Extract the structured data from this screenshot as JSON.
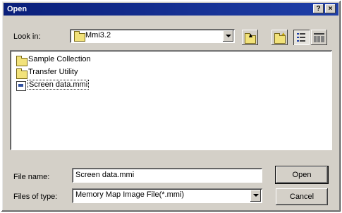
{
  "window": {
    "title": "Open",
    "help_button": "?",
    "close_button": "×"
  },
  "look_in": {
    "label": "Look in:",
    "value": "Mmi3.2"
  },
  "toolbar": {
    "icons": [
      "up-one-level-icon",
      "new-folder-icon",
      "list-view-icon",
      "details-view-icon"
    ],
    "active": "list-view-icon"
  },
  "files": [
    {
      "name": "Sample Collection",
      "type": "folder"
    },
    {
      "name": "Transfer Utility",
      "type": "folder"
    },
    {
      "name": "Screen data.mmi",
      "type": "file",
      "selected": true
    }
  ],
  "file_name": {
    "label": "File name:",
    "value": "Screen data.mmi"
  },
  "file_type": {
    "label": "Files of type:",
    "value": "Memory Map Image File(*.mmi)"
  },
  "buttons": {
    "open": "Open",
    "cancel": "Cancel"
  },
  "colors": {
    "titlebar": "#0a1f7a",
    "dialog_bg": "#d4d0c8"
  }
}
